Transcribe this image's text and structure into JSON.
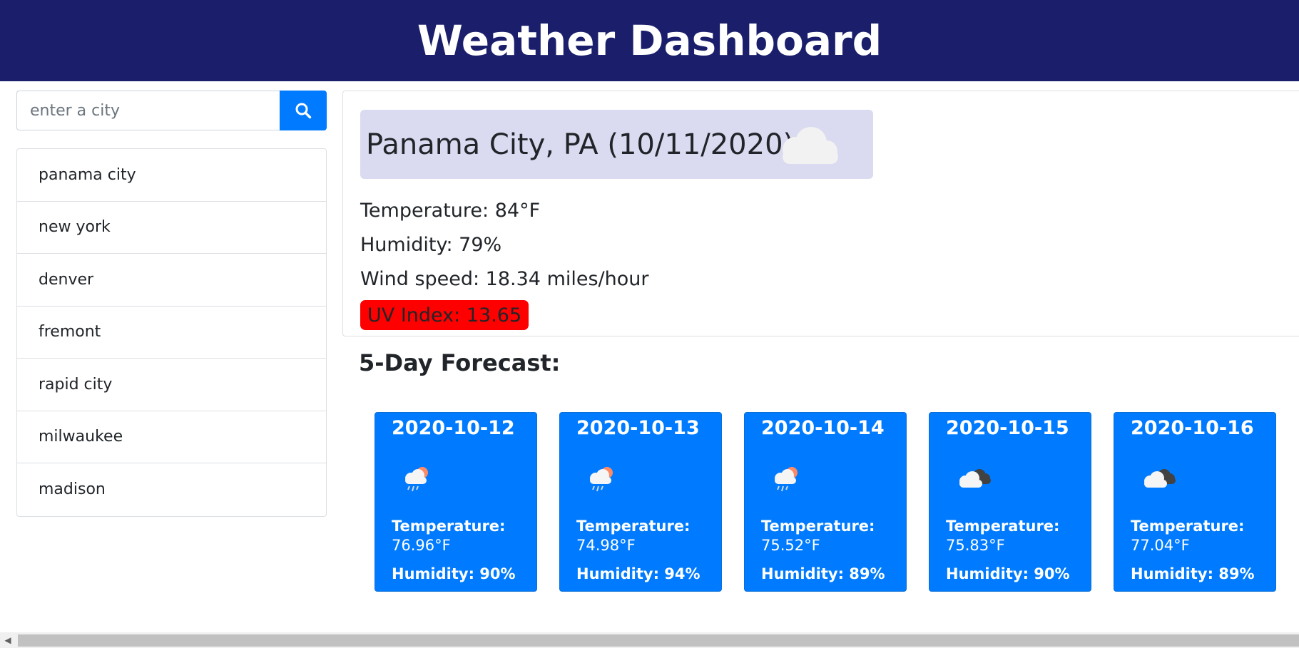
{
  "header": {
    "title": "Weather Dashboard"
  },
  "search": {
    "placeholder": "enter a city",
    "value": "",
    "button_icon": "search-icon"
  },
  "history": {
    "items": [
      "panama city",
      "new york",
      "denver",
      "fremont",
      "rapid city",
      "milwaukee",
      "madison"
    ]
  },
  "current": {
    "title": "Panama City, PA (10/11/2020)",
    "icon": "cloud-icon",
    "temperature": "Temperature: 84°F",
    "humidity": "Humidity: 79%",
    "wind": "Wind speed: 18.34 miles/hour",
    "uv": "UV Index: 13.65",
    "uv_color": "#ff0000",
    "banner_color": "#dadaf0"
  },
  "forecast": {
    "title": "5-Day Forecast:",
    "card_color": "#007bff",
    "days": [
      {
        "date": "2020-10-12",
        "icon": "rain-sun-icon",
        "temp_label": "Temperature:",
        "temp": "76.96°F",
        "humidity": "Humidity: 90%"
      },
      {
        "date": "2020-10-13",
        "icon": "rain-sun-icon",
        "temp_label": "Temperature:",
        "temp": "74.98°F",
        "humidity": "Humidity: 94%"
      },
      {
        "date": "2020-10-14",
        "icon": "rain-sun-icon",
        "temp_label": "Temperature:",
        "temp": "75.52°F",
        "humidity": "Humidity: 89%"
      },
      {
        "date": "2020-10-15",
        "icon": "broken-clouds-icon",
        "temp_label": "Temperature:",
        "temp": "75.83°F",
        "humidity": "Humidity: 90%"
      },
      {
        "date": "2020-10-16",
        "icon": "broken-clouds-icon",
        "temp_label": "Temperature:",
        "temp": "77.04°F",
        "humidity": "Humidity: 89%"
      }
    ]
  },
  "colors": {
    "header_bg": "#1b1f6b",
    "accent": "#007bff"
  }
}
